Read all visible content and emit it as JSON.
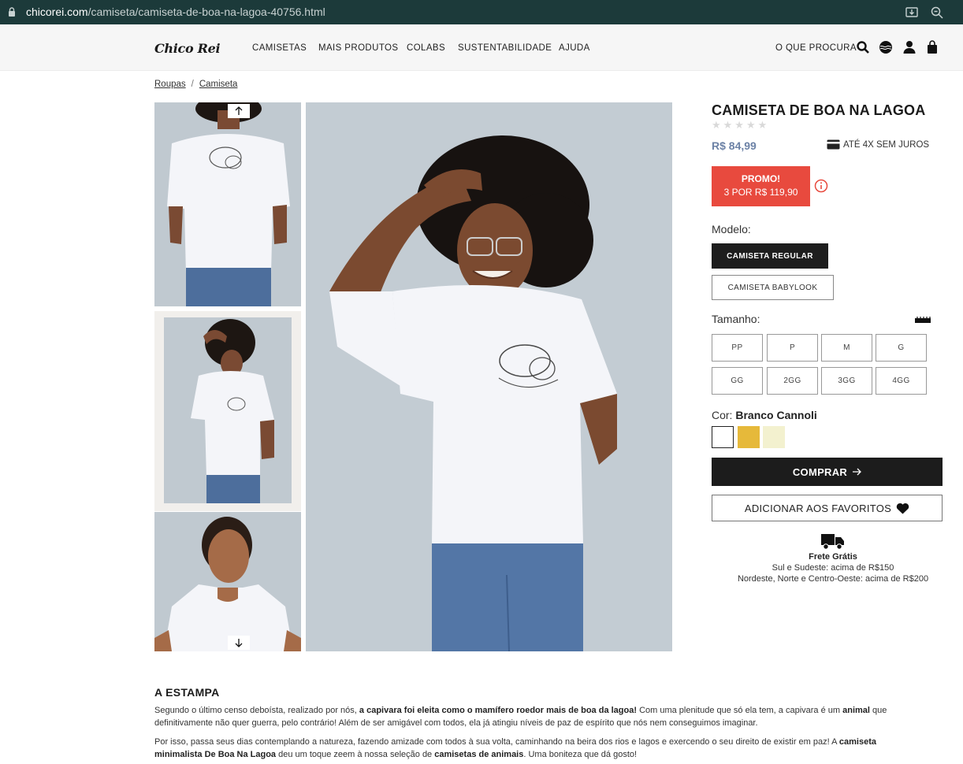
{
  "browser": {
    "url_host": "chicorei.com",
    "url_path": "/camiseta/camiseta-de-boa-na-lagoa-40756.html"
  },
  "header": {
    "logo": "Chico Rei",
    "nav": [
      "CAMISETAS",
      "MAIS PRODUTOS",
      "COLABS",
      "SUSTENTABILIDADE",
      "AJUDA"
    ],
    "search_label": "O QUE PROCURA"
  },
  "breadcrumb": {
    "items": [
      "Roupas",
      "Camiseta"
    ],
    "separator": "/"
  },
  "product": {
    "title": "CAMISETA DE BOA NA LAGOA",
    "rating_stars": "★★★★★",
    "price": "R$ 84,99",
    "installments": "ATÉ 4X SEM JUROS",
    "promo": {
      "line1": "PROMO!",
      "line2": "3 POR R$ 119,90"
    },
    "model_label": "Modelo:",
    "models": [
      "CAMISETA REGULAR",
      "CAMISETA BABYLOOK"
    ],
    "selected_model": "CAMISETA REGULAR",
    "size_label": "Tamanho:",
    "sizes": [
      "PP",
      "P",
      "M",
      "G",
      "GG",
      "2GG",
      "3GG",
      "4GG"
    ],
    "color_label": "Cor:",
    "color_selected": "Branco Cannoli",
    "colors": [
      "#ffffff",
      "#e6b93a",
      "#f3f1cf"
    ],
    "buy_label": "COMPRAR",
    "fav_label": "ADICIONAR AOS FAVORITOS",
    "shipping": {
      "title": "Frete Grátis",
      "line1": "Sul e Sudeste: acima de R$150",
      "line2": "Nordeste, Norte e Centro-Oeste: acima de R$200"
    }
  },
  "description": {
    "title": "A ESTAMPA",
    "p1_a": "Segundo o último censo deboísta, realizado por nós, ",
    "p1_b": "a capivara foi eleita como o mamífero roedor mais de boa da lagoa!",
    "p1_c": " Com uma plenitude que só ela tem, a capivara é um ",
    "p1_d": "animal",
    "p1_e": " que definitivamente não quer guerra, pelo contrário! Além de ser amigável com todos, ela já atingiu níveis de paz de espírito que nós nem conseguimos imaginar.",
    "p2_a": "Por isso, passa seus dias contemplando a natureza, fazendo amizade com todos à sua volta, caminhando na beira dos rios e lagos e exercendo o seu direito de existir em paz! A ",
    "p2_b": "camiseta minimalista De Boa Na Lagoa",
    "p2_c": " deu um toque zeem à nossa seleção de ",
    "p2_d": "camisetas de animais",
    "p2_e": ". Uma boniteza que dá gosto!"
  },
  "colors": {
    "promo": "#e84a3e",
    "price": "#6c82a6",
    "dark": "#1c1c1c"
  }
}
